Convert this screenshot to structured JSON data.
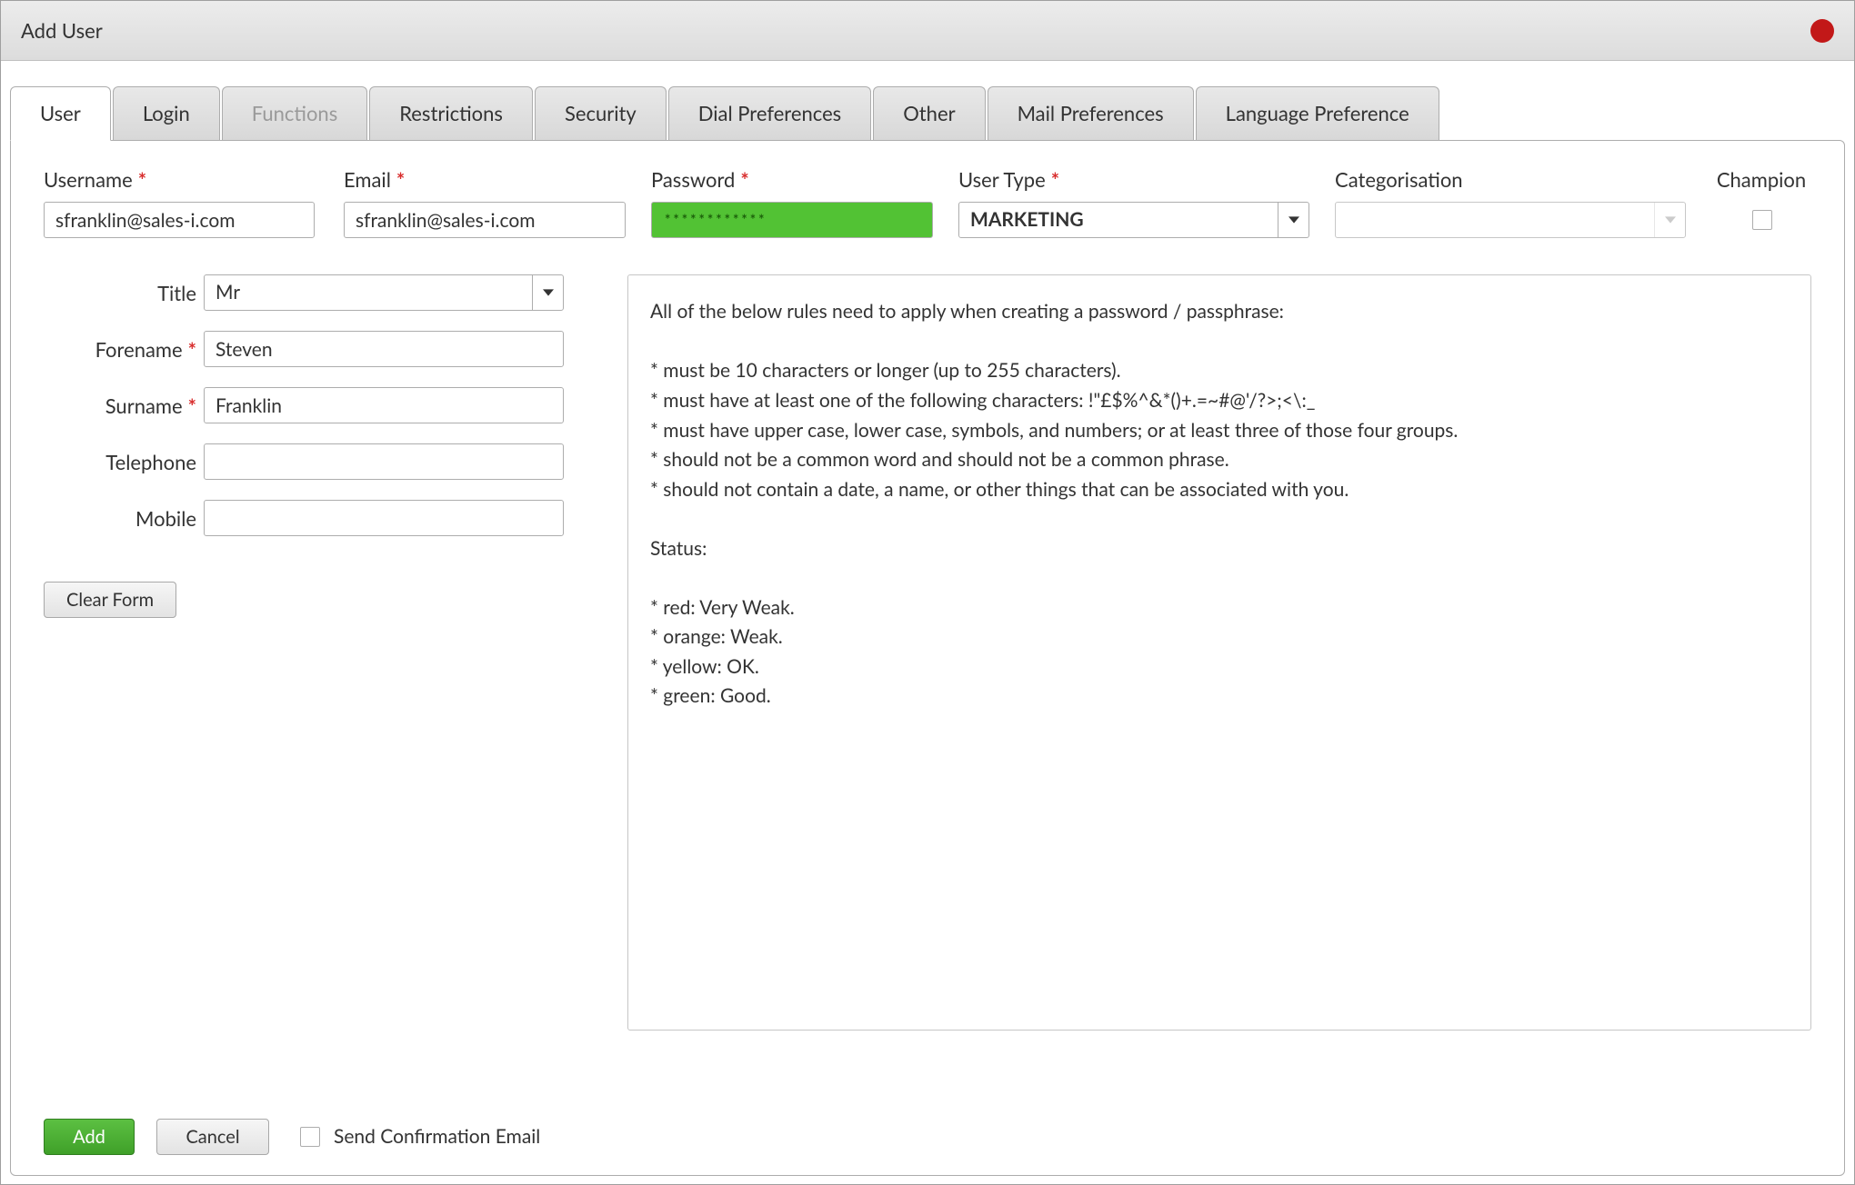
{
  "window_title": "Add User",
  "tabs": [
    {
      "label": "User",
      "active": true,
      "disabled": false
    },
    {
      "label": "Login",
      "active": false,
      "disabled": false
    },
    {
      "label": "Functions",
      "active": false,
      "disabled": true
    },
    {
      "label": "Restrictions",
      "active": false,
      "disabled": false
    },
    {
      "label": "Security",
      "active": false,
      "disabled": false
    },
    {
      "label": "Dial Preferences",
      "active": false,
      "disabled": false
    },
    {
      "label": "Other",
      "active": false,
      "disabled": false
    },
    {
      "label": "Mail Preferences",
      "active": false,
      "disabled": false
    },
    {
      "label": "Language Preference",
      "active": false,
      "disabled": false
    }
  ],
  "labels": {
    "username": "Username",
    "email": "Email",
    "password": "Password",
    "usertype": "User Type",
    "categorisation": "Categorisation",
    "champion": "Champion",
    "title": "Title",
    "forename": "Forename",
    "surname": "Surname",
    "telephone": "Telephone",
    "mobile": "Mobile",
    "req_mark": "*"
  },
  "values": {
    "username": "sfranklin@sales-i.com",
    "email": "sfranklin@sales-i.com",
    "password_masked": "************",
    "usertype": "MARKETING",
    "categorisation": "",
    "champion_checked": false,
    "title": "Mr",
    "forename": "Steven",
    "surname": "Franklin",
    "telephone": "",
    "mobile": ""
  },
  "rules_text": "All of the below rules need to apply when creating a password / passphrase:\n\n  * must be 10 characters or longer (up to 255 characters).\n  * must have at least one of the following characters: !\"£$%^&*()+.=~#@'/?>;<\\:_\n  * must have upper case, lower case, symbols, and numbers; or at least three of those four groups.\n  * should not be a common word and should not be a common phrase.\n  * should not contain a date, a name, or other things that can be associated with you.\n\nStatus:\n\n * red: Very Weak.\n * orange: Weak.\n * yellow: OK.\n * green: Good.",
  "buttons": {
    "clear_form": "Clear Form",
    "add": "Add",
    "cancel": "Cancel",
    "send_confirm": "Send Confirmation Email"
  }
}
